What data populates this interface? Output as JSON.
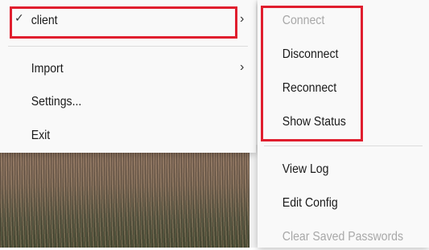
{
  "main_menu": {
    "client_label": "client",
    "import_label": "Import",
    "settings_label": "Settings...",
    "exit_label": "Exit"
  },
  "icons": {
    "check": "✓",
    "chevron": "›"
  },
  "sub_menu": {
    "connect_label": "Connect",
    "disconnect_label": "Disconnect",
    "reconnect_label": "Reconnect",
    "show_status_label": "Show Status",
    "view_log_label": "View Log",
    "edit_config_label": "Edit Config",
    "clear_passwords_label": "Clear Saved Passwords"
  },
  "colors": {
    "highlight_border": "#e01e2e",
    "disabled_text": "#a8a8a8"
  }
}
